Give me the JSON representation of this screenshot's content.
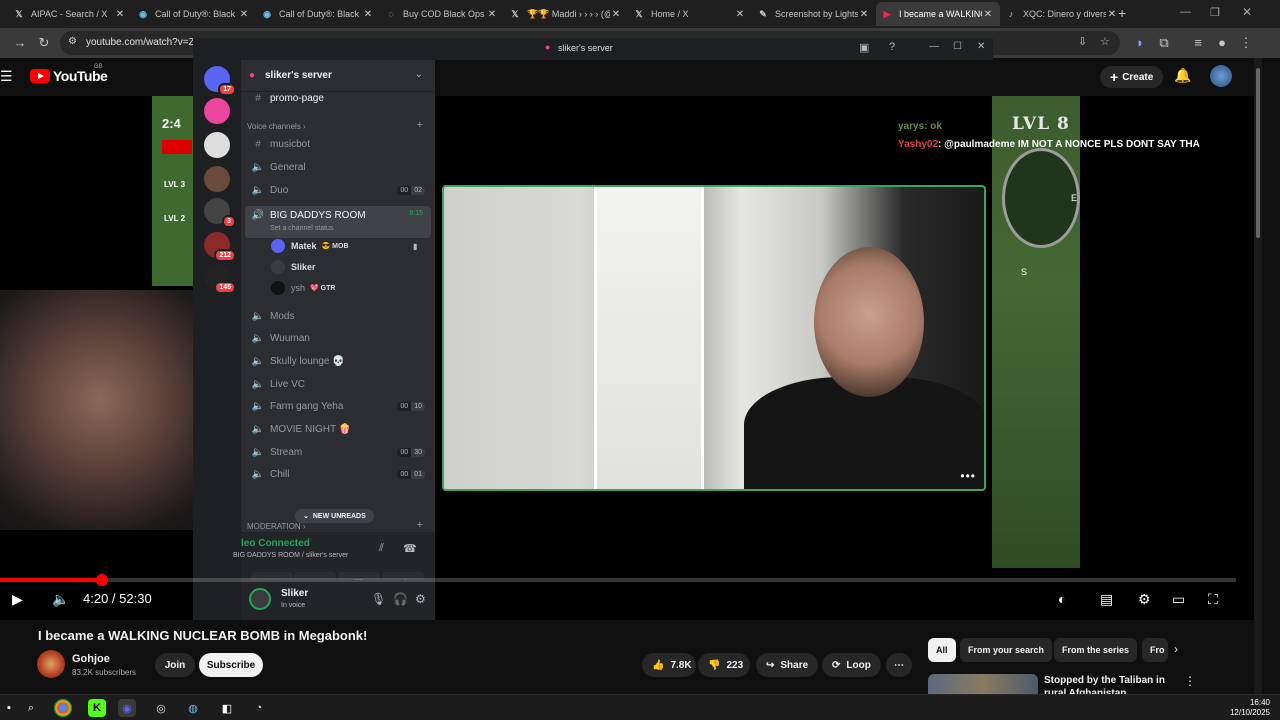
{
  "browser": {
    "tabs": [
      {
        "label": "AIPAC - Search / X",
        "icon": "x-logo-icon",
        "glyph": "𝕏"
      },
      {
        "label": "Call of Duty®: Black Ops",
        "icon": "steam-icon",
        "glyph": "◉"
      },
      {
        "label": "Call of Duty®: Black Ops",
        "icon": "steam-icon",
        "glyph": "◉"
      },
      {
        "label": "Buy COD Black Ops 2",
        "icon": "globe-icon",
        "glyph": "◌"
      },
      {
        "label": "🏆🏆 Maddi › › › › (@",
        "icon": "x-logo-icon",
        "glyph": "𝕏"
      },
      {
        "label": "Home / X",
        "icon": "x-logo-icon",
        "glyph": "𝕏"
      },
      {
        "label": "Screenshot by Lightshot",
        "icon": "feather-icon",
        "glyph": "✎"
      },
      {
        "label": "I became a WALKING",
        "icon": "youtube-icon",
        "glyph": "▶"
      },
      {
        "label": "XQC: Dinero y diversión",
        "icon": "tiktok-icon",
        "glyph": "♪"
      }
    ],
    "new_tab": "+",
    "url": "youtube.com/watch?v=Zy"
  },
  "youtube": {
    "logo_word": "YouTube",
    "region": "GB",
    "create_label": "Create",
    "video_title": "I became a WALKING NUCLEAR BOMB in Megabonk!",
    "channel_name": "Gohjoe",
    "channel_subs": "83.2K subscribers",
    "join_label": "Join",
    "subscribe_label": "Subscribe",
    "likes": "7.8K",
    "dislikes": "223",
    "share_label": "Share",
    "loop_label": "Loop",
    "time_display": "4:20 / 52:30",
    "progress_fraction": 0.0825,
    "chips": [
      "All",
      "From your search",
      "From the series",
      "Fro"
    ],
    "rec_title": "Stopped by the Taliban in rural Afghanistan"
  },
  "overlay": {
    "chat1_user": "yarys",
    "chat1_text": ": ok",
    "chat2_user": "Yashy02",
    "chat2_text": ": @paulmademe IM NOT A NONCE PLS DONT SAY THA",
    "lvl": "LVL 8",
    "lvl_small_1": "LVL 3",
    "lvl_small_2": "LVL 2",
    "timer": "2:4",
    "compass_e": "E",
    "compass_s": "S"
  },
  "discord": {
    "window_title": "sliker's server",
    "server_name": "sliker's server",
    "rail_badges": [
      "17",
      "3",
      "212",
      "145"
    ],
    "channels_top": "promo-page",
    "category": "Voice channels",
    "channels": [
      {
        "name": "musicbot",
        "type": "text"
      },
      {
        "name": "General",
        "type": "voice"
      },
      {
        "name": "Duo",
        "type": "voice",
        "c1": "00",
        "c2": "02"
      }
    ],
    "active_channel": {
      "name": "BIG DADDYS ROOM",
      "time": "9:15",
      "status": "Set a channel status"
    },
    "voice_users": [
      {
        "name": "Matek",
        "tag": "😎 MOB",
        "color": "#5865f2"
      },
      {
        "name": "Sliker",
        "tag": "",
        "color": "#3a3c42"
      },
      {
        "name": "ysh",
        "tag": "💖 GTR",
        "color": "#111111"
      }
    ],
    "channels_after": [
      {
        "name": "Mods"
      },
      {
        "name": "Wuuman"
      },
      {
        "name": "Skully lounge 💀"
      },
      {
        "name": "Live VC"
      },
      {
        "name": "Farm gang Yeha",
        "c1": "00",
        "c2": "10"
      },
      {
        "name": "MOVIE NIGHT 🍿"
      },
      {
        "name": "Stream",
        "c1": "00",
        "c2": "30"
      },
      {
        "name": "Chill",
        "c1": "00",
        "c2": "01"
      }
    ],
    "moderation": "MODERATION",
    "new_unreads": "NEW UNREADS",
    "rtc_status": "leo Connected",
    "rtc_sub": "BIG DADDYS ROOM / sliker's server",
    "user_name": "Sliker",
    "user_status": "In voice"
  },
  "taskbar": {
    "time": "16:40",
    "date": "12/10/2025"
  },
  "colors": {
    "yt_red": "#ff0000",
    "discord_green": "#23a55a",
    "discord_bg": "#2b2d31"
  }
}
